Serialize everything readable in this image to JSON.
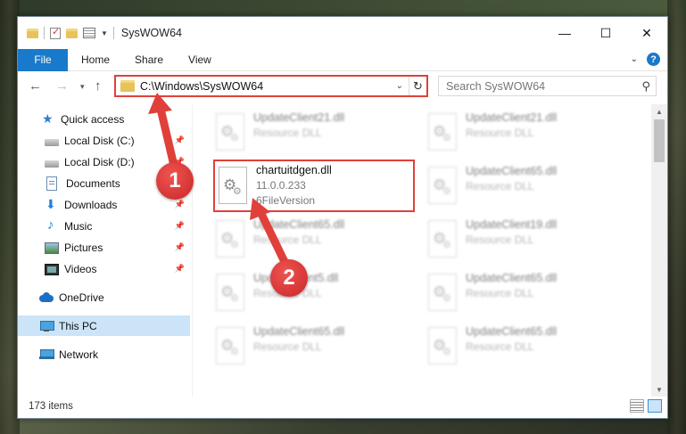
{
  "window": {
    "title": "SysWOW64",
    "controls": {
      "minimize": "—",
      "maximize": "☐",
      "close": "✕"
    }
  },
  "ribbon": {
    "tabs": [
      "File",
      "Home",
      "Share",
      "View"
    ],
    "expand_icon": "chevron-down-icon",
    "help": "?"
  },
  "address": {
    "path": "C:\\Windows\\SysWOW64",
    "search_placeholder": "Search SysWOW64"
  },
  "sidebar": {
    "items": [
      {
        "label": "Quick access",
        "icon": "star-icon",
        "pinned": false
      },
      {
        "label": "Local Disk (C:)",
        "icon": "disk-icon",
        "pinned": true
      },
      {
        "label": "Local Disk (D:)",
        "icon": "disk-icon",
        "pinned": true
      },
      {
        "label": "Documents",
        "icon": "documents-icon",
        "pinned": true
      },
      {
        "label": "Downloads",
        "icon": "downloads-icon",
        "pinned": true
      },
      {
        "label": "Music",
        "icon": "music-icon",
        "pinned": true
      },
      {
        "label": "Pictures",
        "icon": "pictures-icon",
        "pinned": true
      },
      {
        "label": "Videos",
        "icon": "videos-icon",
        "pinned": true
      },
      {
        "label": "OneDrive",
        "icon": "onedrive-icon",
        "pinned": false
      },
      {
        "label": "This PC",
        "icon": "this-pc-icon",
        "pinned": false,
        "selected": true
      },
      {
        "label": "Network",
        "icon": "network-icon",
        "pinned": false
      }
    ]
  },
  "files": {
    "left": [
      {
        "name": "UpdateClient21.dll",
        "desc": "Resource DLL"
      },
      {
        "name": "chartuitdgen.dll",
        "desc": "11.0.0.233",
        "desc2": "6FileVersion",
        "highlighted": true
      },
      {
        "name": "UpdateClient65.dll",
        "desc": "Resource DLL"
      },
      {
        "name": "UpdateClient5.dll",
        "desc": "Resource DLL"
      },
      {
        "name": "UpdateClient65.dll",
        "desc": "Resource DLL"
      }
    ],
    "right": [
      {
        "name": "UpdateClient21.dll",
        "desc": "Resource DLL"
      },
      {
        "name": "UpdateClient65.dll",
        "desc": "Resource DLL"
      },
      {
        "name": "UpdateClient19.dll",
        "desc": "Resource DLL"
      },
      {
        "name": "UpdateClient65.dll",
        "desc": "Resource DLL"
      },
      {
        "name": "UpdateClient65.dll",
        "desc": "Resource DLL"
      }
    ]
  },
  "status": {
    "item_count": "173 items"
  },
  "annotations": {
    "step1": "1",
    "step2": "2"
  },
  "colors": {
    "accent": "#1979ca",
    "highlight": "#e0403a",
    "selected": "#cce4f7"
  }
}
